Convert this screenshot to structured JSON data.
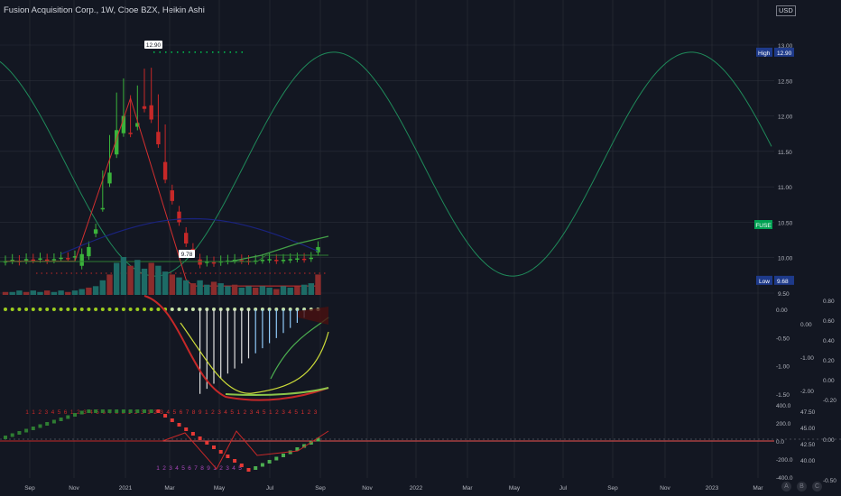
{
  "title": "Fusion Acquisition Corp., 1W, Cboe BZX, Heikin Ashi",
  "currency": "USD",
  "axis_buttons": [
    "A",
    "B",
    "C"
  ],
  "colors": {
    "bg": "#131722",
    "grid": "#2a2e39",
    "text": "#d1d4dc",
    "up": "#2ea043",
    "down": "#ef5350",
    "cycle": "#1f8a5a",
    "accent": "#00c853"
  },
  "chart_data": [
    {
      "type": "candlestick",
      "name": "price",
      "x_tick_labels": [
        "Sep",
        "Nov",
        "2021",
        "Mar",
        "May",
        "Jul",
        "Sep",
        "Nov",
        "2022",
        "Mar",
        "May",
        "Jul",
        "Sep",
        "Nov",
        "2023",
        "Mar"
      ],
      "y_tick_labels": [
        "13.00",
        "12.50",
        "12.00",
        "11.50",
        "11.00",
        "10.50",
        "10.00",
        "9.50"
      ],
      "ylim": [
        9.5,
        13.0
      ],
      "price_label": "FUSE",
      "high_label": "High",
      "high_value": "12.90",
      "low_label": "Low",
      "low_value": "9.68",
      "high_marker": "12.90",
      "low_marker": "9.78",
      "closes": [
        9.95,
        9.97,
        9.94,
        9.98,
        9.97,
        9.99,
        9.96,
        9.98,
        10.0,
        9.99,
        10.02,
        10.05,
        10.15,
        10.4,
        10.7,
        11.2,
        11.8,
        12.0,
        11.75,
        11.9,
        12.1,
        11.95,
        11.6,
        11.1,
        10.8,
        10.5,
        10.2,
        10.05,
        9.9,
        9.95,
        9.92,
        9.95,
        9.96,
        9.97,
        9.96,
        9.95,
        9.96,
        9.97,
        9.98,
        9.96,
        9.97,
        9.98,
        9.99,
        9.98,
        10.0,
        10.15
      ],
      "max_high": 12.9,
      "min_low": 9.78
    },
    {
      "type": "histogram",
      "name": "volume",
      "values": [
        2,
        2,
        3,
        2,
        3,
        2,
        3,
        2,
        3,
        2,
        3,
        4,
        5,
        6,
        10,
        14,
        22,
        26,
        20,
        24,
        18,
        22,
        20,
        16,
        14,
        12,
        10,
        8,
        10,
        7,
        9,
        8,
        6,
        7,
        5,
        6,
        5,
        6,
        5,
        4,
        6,
        5,
        6,
        7,
        8,
        14
      ]
    },
    {
      "type": "line",
      "name": "oscillator-1",
      "y_tick_labels_left": [
        "0.00",
        "-0.50",
        "-1.00",
        "-1.50"
      ],
      "y_tick_labels_right": [
        "0.80",
        "0.60",
        "0.40",
        "0.20",
        "0.00",
        "-0.20"
      ],
      "y_tick_labels_mid": [
        "0.00",
        "-1.00",
        "-2.00"
      ],
      "ylim": [
        -1.8,
        0.2
      ]
    },
    {
      "type": "line",
      "name": "oscillator-2",
      "y_tick_labels_left": [
        "400.0",
        "200.0",
        "0.0",
        "-200.0",
        "-400.0"
      ],
      "y_tick_labels_right": [
        "0.00",
        "-0.50"
      ],
      "y_tick_labels_mid": [
        "47.50",
        "45.00",
        "42.50",
        "40.00"
      ],
      "count_labels_top": [
        "1",
        "1",
        "2",
        "3",
        "4",
        "5",
        "6",
        "1",
        "2",
        "3",
        "4",
        "5",
        "6",
        "7",
        "8",
        "9",
        "1",
        "2",
        "3",
        "1",
        "2",
        "3",
        "4",
        "5",
        "6",
        "7",
        "8",
        "9",
        "1",
        "2",
        "3",
        "4",
        "5",
        "1",
        "2",
        "3",
        "4",
        "5",
        "1",
        "2",
        "3",
        "4",
        "5",
        "1",
        "2",
        "3"
      ],
      "count_labels_bottom": [
        "1",
        "2",
        "3",
        "4",
        "5",
        "6",
        "7",
        "8",
        "9",
        "1",
        "2",
        "3",
        "4",
        "5"
      ]
    }
  ]
}
